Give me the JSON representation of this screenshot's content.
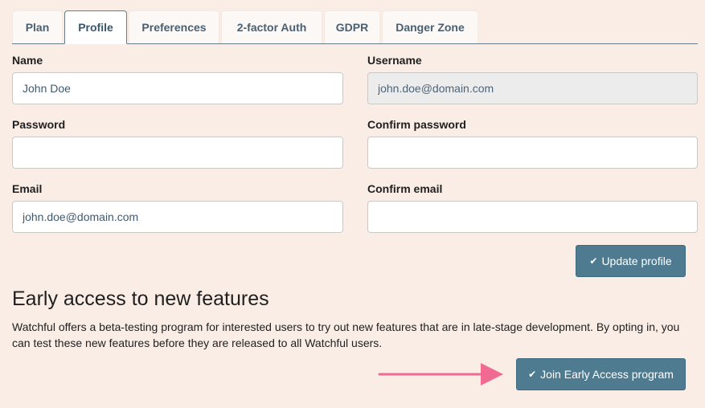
{
  "tabs": [
    {
      "label": "Plan",
      "active": false
    },
    {
      "label": "Profile",
      "active": true
    },
    {
      "label": "Preferences",
      "active": false
    },
    {
      "label": "2-factor Auth",
      "active": false
    },
    {
      "label": "GDPR",
      "active": false
    },
    {
      "label": "Danger Zone",
      "active": false
    }
  ],
  "form": {
    "name_label": "Name",
    "name_value": "John Doe",
    "username_label": "Username",
    "username_value": "john.doe@domain.com",
    "password_label": "Password",
    "password_value": "",
    "confirm_password_label": "Confirm password",
    "confirm_password_value": "",
    "email_label": "Email",
    "email_value": "john.doe@domain.com",
    "confirm_email_label": "Confirm email",
    "confirm_email_value": "",
    "update_button_label": "Update profile"
  },
  "early_access": {
    "heading": "Early access to new features",
    "description": "Watchful offers a beta-testing program for interested users to try out new features that are in late-stage development. By opting in, you can test these new features before they are released to all Watchful users.",
    "join_button_label": "Join Early Access program"
  },
  "icons": {
    "check": "✔",
    "arrow": "arrow-right-icon"
  },
  "colors": {
    "background": "#f9ede6",
    "button": "#4e7b90",
    "tab_text": "#4a6071",
    "arrow": "#f06a92"
  }
}
